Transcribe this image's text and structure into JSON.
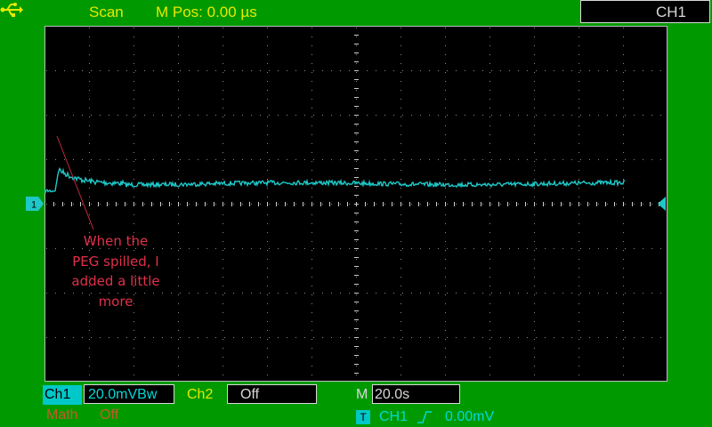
{
  "status": "Scan",
  "mpos": "M Pos: 0.00 µs",
  "channel_selector": "CH1",
  "annotation": {
    "lines": [
      "When the",
      "PEG spilled, I",
      "added a little",
      "more"
    ]
  },
  "bottom": {
    "ch1_label": "Ch1",
    "ch1_scale": "20.0mVBw",
    "ch2_label": "Ch2",
    "ch2_state": "Off",
    "m_label": "M",
    "timebase": "20.0s",
    "math_label": "Math",
    "math_state": "Off",
    "trigger_badge": "T",
    "trigger_source": "CH1",
    "trigger_level": "0.00mV"
  },
  "icons": {
    "usb": "usb-icon",
    "ground_marker": "channel-ground-marker-icon",
    "trigger_marker": "trigger-level-arrow-icon",
    "slope": "rising-edge-icon"
  },
  "colors": {
    "bezel": "#009a00",
    "screen": "#000000",
    "trace": "#1ec8c8",
    "status_text": "#e8e800",
    "annotation": "#e0304a"
  },
  "waveform": {
    "timebase_s_per_div": 20.0,
    "volts_per_div_mV": 20.0,
    "baseline_mV": 9.0,
    "spike_mV": 15.5
  }
}
